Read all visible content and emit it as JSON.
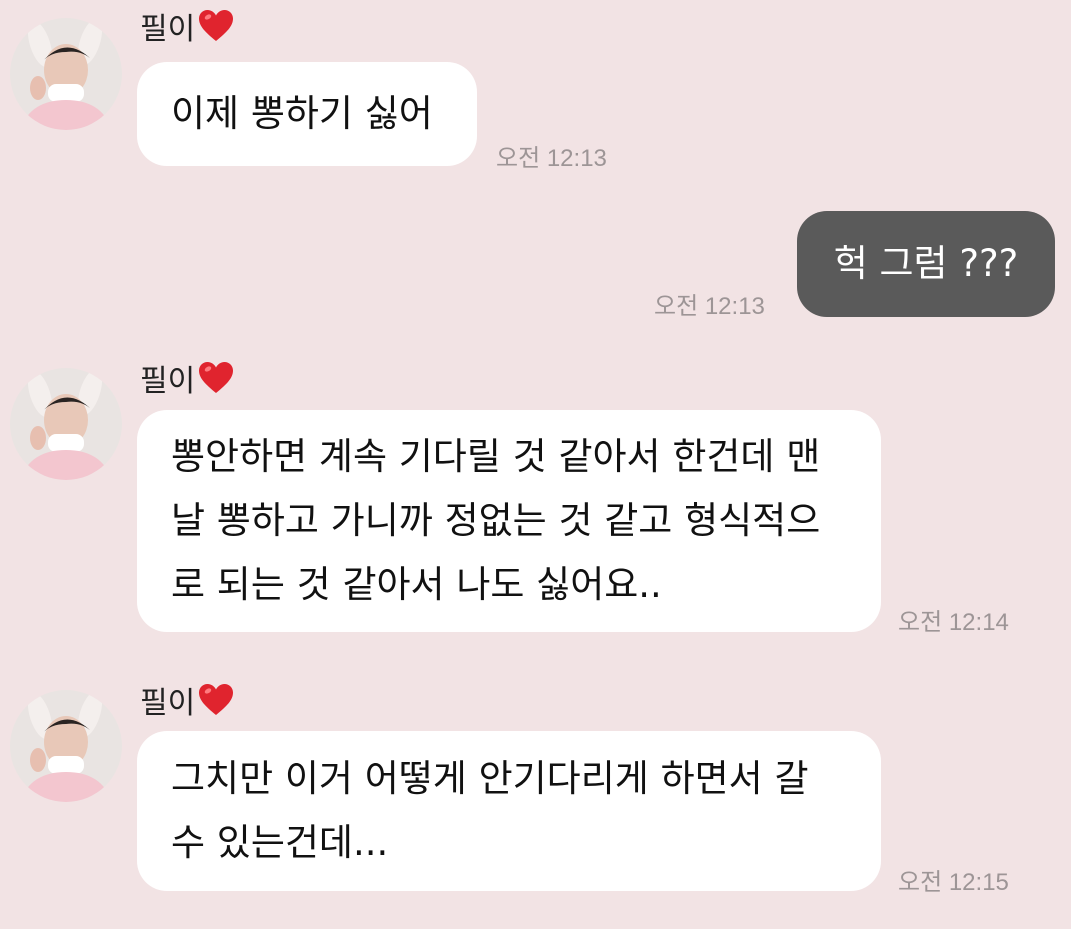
{
  "contact": {
    "name": "필이",
    "name_icon": "red-heart-icon",
    "avatar_icon": "profile-photo-avatar"
  },
  "colors": {
    "background": "#f2e3e4",
    "incoming_bubble": "#ffffff",
    "outgoing_bubble": "#5a5a5a",
    "timestamp": "#9d9596",
    "heart": "#e0242e"
  },
  "messages": [
    {
      "direction": "incoming",
      "sender": "필이",
      "lines": [
        "이제 뽕하기 싫어"
      ],
      "time": "오전 12:13"
    },
    {
      "direction": "outgoing",
      "lines": [
        "헉 그럼 ???"
      ],
      "time": "오전 12:13"
    },
    {
      "direction": "incoming",
      "sender": "필이",
      "lines": [
        "뽕안하면 계속 기다릴 것 같아서 한건데 맨",
        "날 뽕하고 가니까 정없는 것 같고 형식적으",
        "로 되는 것 같아서 나도 싫어요.."
      ],
      "time": "오전 12:14"
    },
    {
      "direction": "incoming",
      "sender": "필이",
      "lines": [
        "그치만 이거 어떻게 안기다리게 하면서 갈",
        "수 있는건데..."
      ],
      "time": "오전 12:15"
    }
  ]
}
